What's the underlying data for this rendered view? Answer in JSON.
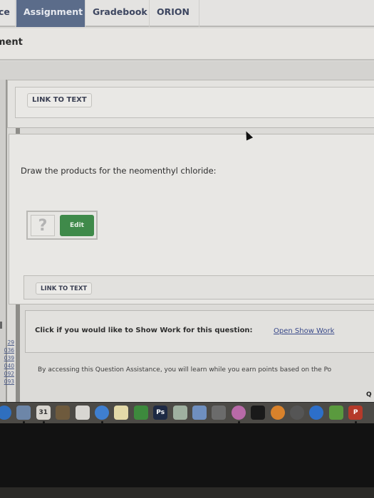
{
  "nav": {
    "tabs": [
      {
        "label": "ce",
        "active": false
      },
      {
        "label": "Assignment",
        "active": true
      },
      {
        "label": "Gradebook",
        "active": false
      },
      {
        "label": "ORION",
        "active": false
      }
    ]
  },
  "page": {
    "heading": "ment"
  },
  "top_panel": {
    "link_to_text_label": "LINK TO TEXT"
  },
  "question": {
    "prompt": "Draw the products for the neomenthyl chloride:",
    "answer_placeholder": "?",
    "edit_button_label": "Edit",
    "link_to_text_label": "LINK TO TEXT"
  },
  "show_work": {
    "prompt": "Click if you would like to Show Work for this question:",
    "link_label": "Open Show Work"
  },
  "assistance": {
    "text": "By accessing this Question Assistance, you will learn while you earn points based on the Po",
    "trailing_fragment": "Q"
  },
  "side_links": [
    "29",
    "036",
    "039",
    "040",
    "092",
    "093"
  ],
  "dock": {
    "apps": [
      {
        "name": "safari",
        "label": "",
        "color": "#2f6fbf"
      },
      {
        "name": "mail",
        "label": "",
        "color": "#6d86a8"
      },
      {
        "name": "calendar",
        "label": "31",
        "color": "#d9d6d0"
      },
      {
        "name": "contacts",
        "label": "",
        "color": "#6e5a3d"
      },
      {
        "name": "reminders",
        "label": "",
        "color": "#d8d6d2"
      },
      {
        "name": "messages",
        "label": "",
        "color": "#3f7fd0"
      },
      {
        "name": "notes",
        "label": "",
        "color": "#e3d9a8"
      },
      {
        "name": "facetime",
        "label": "",
        "color": "#3d8a3d"
      },
      {
        "name": "photoshop",
        "label": "Ps",
        "color": "#1e2a44"
      },
      {
        "name": "preview",
        "label": "",
        "color": "#9fb0a0"
      },
      {
        "name": "keynote",
        "label": "",
        "color": "#6f8fbf"
      },
      {
        "name": "numbers",
        "label": "",
        "color": "#6b6b6b"
      },
      {
        "name": "itunes",
        "label": "",
        "color": "#b86aa8"
      },
      {
        "name": "gopro",
        "label": "",
        "color": "#1a1a1a"
      },
      {
        "name": "ibooks",
        "label": "",
        "color": "#d9822b"
      },
      {
        "name": "time-machine",
        "label": "",
        "color": "#555555"
      },
      {
        "name": "app-store",
        "label": "",
        "color": "#2d6fc9"
      },
      {
        "name": "green-app",
        "label": "",
        "color": "#5a9a3e"
      },
      {
        "name": "powerpoint",
        "label": "P",
        "color": "#b53a2a"
      }
    ]
  }
}
